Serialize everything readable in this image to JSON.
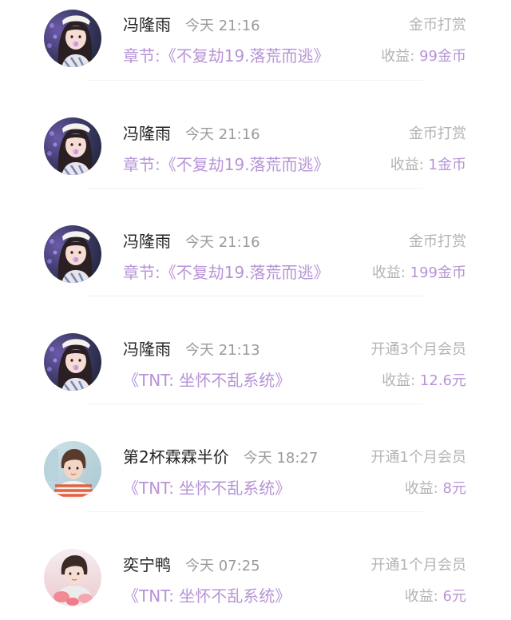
{
  "items": [
    {
      "name": "冯隆雨",
      "time": "今天 21:16",
      "subtitle": "章节:《不复劫19.落荒而逃》",
      "type": "金币打赏",
      "income_label": "收益:",
      "income_value": "99金币",
      "avatar": "girl"
    },
    {
      "name": "冯隆雨",
      "time": "今天 21:16",
      "subtitle": "章节:《不复劫19.落荒而逃》",
      "type": "金币打赏",
      "income_label": "收益:",
      "income_value": "1金币",
      "avatar": "girl"
    },
    {
      "name": "冯隆雨",
      "time": "今天 21:16",
      "subtitle": "章节:《不复劫19.落荒而逃》",
      "type": "金币打赏",
      "income_label": "收益:",
      "income_value": "199金币",
      "avatar": "girl"
    },
    {
      "name": "冯隆雨",
      "time": "今天 21:13",
      "subtitle": "《TNT: 坐怀不乱系统》",
      "type": "开通3个月会员",
      "income_label": "收益:",
      "income_value": "12.6元",
      "avatar": "girl"
    },
    {
      "name": "第2杯霖霖半价",
      "time": "今天 18:27",
      "subtitle": "《TNT: 坐怀不乱系统》",
      "type": "开通1个月会员",
      "income_label": "收益:",
      "income_value": "8元",
      "avatar": "boy-stripes"
    },
    {
      "name": "奕宁鸭",
      "time": "今天 07:25",
      "subtitle": "《TNT: 坐怀不乱系统》",
      "type": "开通1个月会员",
      "income_label": "收益:",
      "income_value": "6元",
      "avatar": "person-pink"
    }
  ]
}
